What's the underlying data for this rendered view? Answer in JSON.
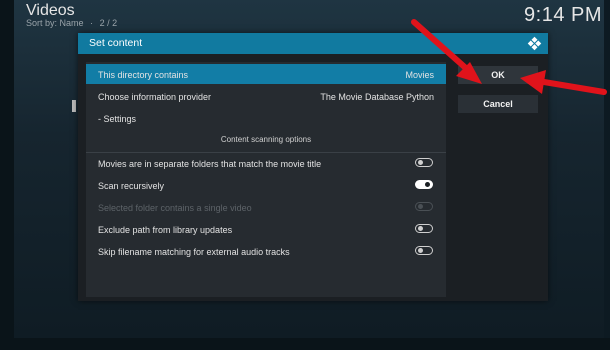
{
  "header": {
    "title": "Videos",
    "sort_label": "Sort by: Name",
    "separator": "·",
    "page": "2 / 2",
    "clock": "9:14 PM"
  },
  "dialog": {
    "title": "Set content",
    "rows": [
      {
        "label": "This directory contains",
        "value": "Movies"
      },
      {
        "label": "Choose information provider",
        "value": "The Movie Database Python"
      },
      {
        "label": "- Settings",
        "value": ""
      }
    ],
    "section_label": "Content scanning options",
    "options": [
      {
        "label": "Movies are in separate folders that match the movie title",
        "state": "off"
      },
      {
        "label": "Scan recursively",
        "state": "on"
      },
      {
        "label": "Selected folder contains a single video",
        "state": "disabled"
      },
      {
        "label": "Exclude path from library updates",
        "state": "off"
      },
      {
        "label": "Skip filename matching for external audio tracks",
        "state": "off"
      }
    ],
    "buttons": {
      "ok": "OK",
      "cancel": "Cancel"
    }
  },
  "colors": {
    "accent": "#117aa0",
    "selected_row": "#127da6",
    "annotation_arrow": "#e0131b"
  },
  "icons": {
    "dialog_logo": "kodi-logo-icon"
  }
}
